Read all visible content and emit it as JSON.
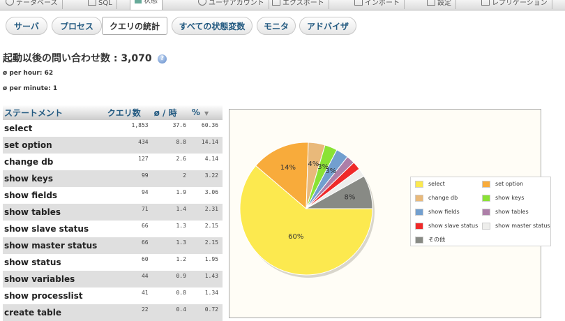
{
  "top_tabs": [
    {
      "label": "データベース",
      "icon": "database-icon"
    },
    {
      "label": "SQL",
      "icon": "sql-icon"
    },
    {
      "label": "状態",
      "icon": "status-icon",
      "active": true
    },
    {
      "label": "ユーザアカウント",
      "icon": "users-icon"
    },
    {
      "label": "エクスポート",
      "icon": "export-icon"
    },
    {
      "label": "インポート",
      "icon": "import-icon"
    },
    {
      "label": "設定",
      "icon": "wrench-icon"
    },
    {
      "label": "レプリケーション",
      "icon": "replication-icon"
    }
  ],
  "sub_tabs": [
    {
      "label": "サーバ"
    },
    {
      "label": "プロセス"
    },
    {
      "label": "クエリの統計",
      "active": true
    },
    {
      "label": "すべての状態変数"
    },
    {
      "label": "モニタ"
    },
    {
      "label": "アドバイザ"
    }
  ],
  "summary": {
    "title": "起動以後の問い合わせ数 : 3,070",
    "per_hour": "ø per hour: 62",
    "per_minute": "ø per minute: 1"
  },
  "table": {
    "headers": [
      "ステートメント",
      "クエリ数",
      "ø / 時",
      "%"
    ],
    "rows": [
      [
        "select",
        "1,853",
        "37.6",
        "60.36"
      ],
      [
        "set option",
        "434",
        "8.8",
        "14.14"
      ],
      [
        "change db",
        "127",
        "2.6",
        "4.14"
      ],
      [
        "show keys",
        "99",
        "2",
        "3.22"
      ],
      [
        "show fields",
        "94",
        "1.9",
        "3.06"
      ],
      [
        "show tables",
        "71",
        "1.4",
        "2.31"
      ],
      [
        "show slave status",
        "66",
        "1.3",
        "2.15"
      ],
      [
        "show master status",
        "66",
        "1.3",
        "2.15"
      ],
      [
        "show status",
        "60",
        "1.2",
        "1.95"
      ],
      [
        "show variables",
        "44",
        "0.9",
        "1.43"
      ],
      [
        "show processlist",
        "41",
        "0.8",
        "1.34"
      ],
      [
        "create table",
        "22",
        "0.4",
        "0.72"
      ]
    ]
  },
  "chart_data": {
    "type": "pie",
    "series": [
      {
        "name": "select",
        "value": 60,
        "label": "60%",
        "color": "#fce94f"
      },
      {
        "name": "set option",
        "value": 14,
        "label": "14%",
        "color": "#f8ab3b"
      },
      {
        "name": "change db",
        "value": 4,
        "label": "4%",
        "color": "#e9b97a"
      },
      {
        "name": "show keys",
        "value": 3,
        "label": "3%",
        "color": "#8ae234"
      },
      {
        "name": "show fields",
        "value": 3,
        "label": "3%",
        "color": "#729fcf"
      },
      {
        "name": "show tables",
        "value": 2,
        "label": "",
        "color": "#ad7fa8"
      },
      {
        "name": "show slave status",
        "value": 2,
        "label": "",
        "color": "#ef2929"
      },
      {
        "name": "show master status",
        "value": 2,
        "label": "",
        "color": "#eeeeec"
      },
      {
        "name": "その他",
        "value": 8,
        "label": "8%",
        "color": "#888a85"
      }
    ],
    "legend_position": "right"
  }
}
